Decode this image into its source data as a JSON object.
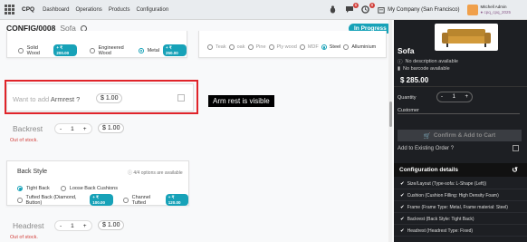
{
  "navbar": {
    "app_name": "CPQ",
    "menu": [
      "Dashboard",
      "Operations",
      "Products",
      "Configuration"
    ],
    "chat_badge": "6",
    "activity_badge": "8",
    "company": "My Company (San Francisco)",
    "user_name": "Mitchell Admin",
    "user_db": "● cpq_cpq_2025"
  },
  "breadcrumb": {
    "ref": "CONFIG/0008",
    "product": "Sofa"
  },
  "status": "In Progress",
  "material": {
    "opt1": "Solid Wood",
    "opt1_price": "+ ₹ 200.00",
    "opt2": "Engineered Wood",
    "opt3": "Metal",
    "opt3_price": "+ ₹ 250.00"
  },
  "frame": {
    "opts": [
      "Teak",
      "oak",
      "Pine",
      "Ply wood",
      "MDF",
      "Steel",
      "Alluminium"
    ]
  },
  "armrest": {
    "label_prefix": "Want to add",
    "label_main": "Armrest ?",
    "price": "$ 1.00"
  },
  "callout": "Arm rest is visible",
  "backrest": {
    "title": "Backrest",
    "qty": "1",
    "minus": "-",
    "plus": "+",
    "price": "$ 1.00",
    "stock": "Out of stock."
  },
  "back_style": {
    "title": "Back Style",
    "available": "ⓘ 4/4 options are available",
    "opt1": "Tight Back",
    "opt2": "Loose Back Cushions",
    "opt3": "Tufted Back (Diamond, Button)",
    "opt3_price": "+ ₹ 100.00",
    "opt4": "Channel Tufted",
    "opt4_price": "+ ₹ 120.00"
  },
  "headrest": {
    "title": "Headrest",
    "qty": "1",
    "minus": "-",
    "plus": "+",
    "price": "$ 1.00",
    "stock": "Out of stock."
  },
  "panel": {
    "title": "Sofa",
    "no_desc": "No description available",
    "no_barcode": "No barcode available",
    "price": "$ 285.00",
    "qty_label": "Quantity",
    "qty": "1",
    "minus": "-",
    "plus": "+",
    "customer_label": "Customer",
    "confirm": "Confirm & Add to Cart",
    "add_existing": "Add to Existing Order ?",
    "config_header": "Configuration details",
    "config_items": [
      "Size/Layout (Type-sofa: L-Shape (Left))",
      "Cushion (Cushion Filling: High Density Foam)",
      "Frame (Frame Type: Metal, Frame material: Steel)",
      "Backrest (Back Style: Tight Back)",
      "Headrest (Headrest Type: Fixed)"
    ]
  },
  "colors": {
    "accent": "#17a2b8",
    "highlight": "#e0242a",
    "panel_bg": "#1d1f23",
    "stock_red": "#d23f3a"
  }
}
